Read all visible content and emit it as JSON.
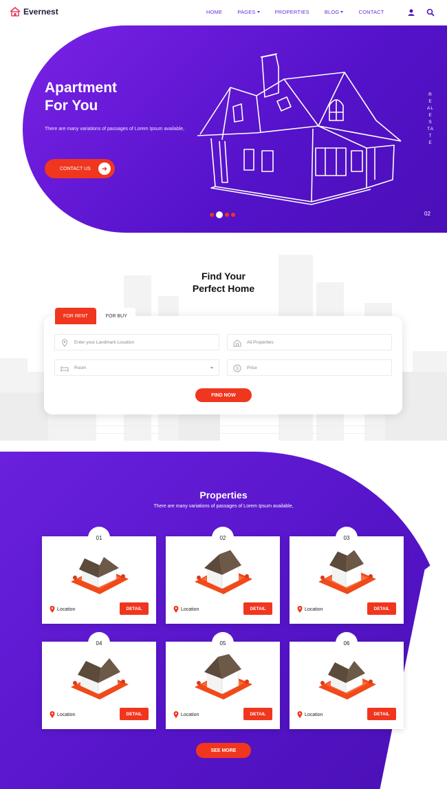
{
  "header": {
    "logo_text": "Evernest",
    "nav": [
      {
        "label": "HOME",
        "dropdown": false
      },
      {
        "label": "PAGES",
        "dropdown": true
      },
      {
        "label": "PROPERTIES",
        "dropdown": false
      },
      {
        "label": "BLOG",
        "dropdown": true
      },
      {
        "label": "CONTACT",
        "dropdown": false
      }
    ],
    "icons": [
      "user-icon",
      "search-icon"
    ]
  },
  "hero": {
    "title_line1": "Apartment",
    "title_line2": "For You",
    "description": "There are many variations of passages of Lorem Ipsum available,",
    "button_label": "CONTACT US",
    "vertical_text": "REALESTATE",
    "slide_number": "02",
    "slides_count": 4,
    "active_slide": 2
  },
  "search": {
    "title_line1": "Find Your",
    "title_line2": "Perfect Home",
    "tabs": [
      {
        "label": "FOR RENT",
        "active": true
      },
      {
        "label": "FOR BUY",
        "active": false
      }
    ],
    "fields": {
      "location_placeholder": "Enter your Landmark Location",
      "property_type": "All Properties",
      "room": "Room",
      "price": "Price"
    },
    "button_label": "FIND NOW"
  },
  "properties": {
    "title": "Properties",
    "subtitle": "There are many variations of passages of Lorem Ipsum available,",
    "items": [
      {
        "number": "01",
        "location": "Location",
        "button": "DETAIL"
      },
      {
        "number": "02",
        "location": "Location",
        "button": "DETAIL"
      },
      {
        "number": "03",
        "location": "Location",
        "button": "DETAIL"
      },
      {
        "number": "04",
        "location": "Location",
        "button": "DETAIL"
      },
      {
        "number": "05",
        "location": "Location",
        "button": "DETAIL"
      },
      {
        "number": "06",
        "location": "Location",
        "button": "DETAIL"
      }
    ],
    "see_more_label": "SEE MORE"
  },
  "colors": {
    "primary_purple": "#6a20dc",
    "accent_red": "#f0361e",
    "nav_text": "#6a2bd6"
  }
}
